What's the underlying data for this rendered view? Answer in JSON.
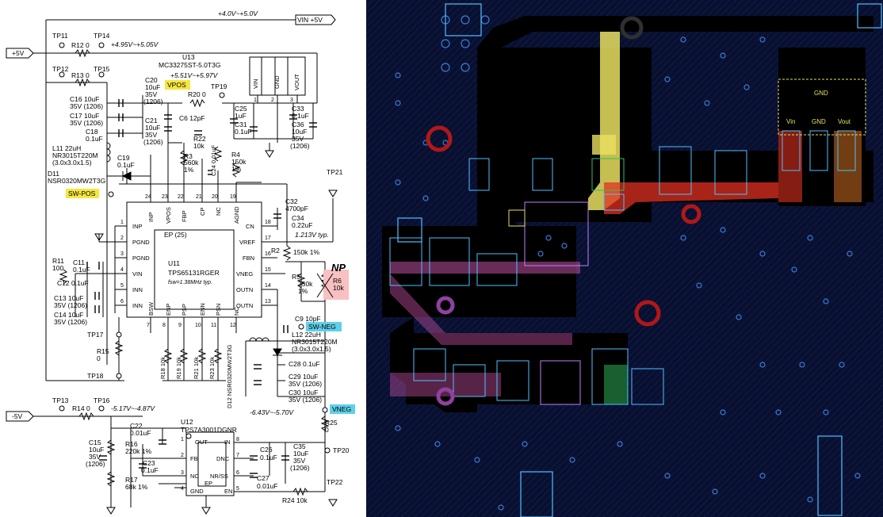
{
  "schematic": {
    "nets": {
      "vin_range": "+4.0V~+5.0V",
      "vin_label": "VIN +5V",
      "plus5": "+5V",
      "minus5": "-5V",
      "tp14_range": "+4.95V~+5.05V",
      "vpos_range": "+5.51V~+5.97V",
      "vneg_range": "-6.43V~-5.70V",
      "tp16_range": "-5.17V~-4.87V",
      "vref_note": "1.213V typ.",
      "np": "NP"
    },
    "tags": {
      "vpos": "VPOS",
      "sw_pos": "SW-POS",
      "sw_neg": "SW-NEG",
      "vneg": "VNEG"
    },
    "tps": [
      "TP11",
      "TP14",
      "TP12",
      "TP15",
      "TP19",
      "TP21",
      "TP17",
      "TP18",
      "TP13",
      "TP16",
      "TP20",
      "TP22"
    ],
    "u13": {
      "ref": "U13",
      "part": "MC33275ST-5.0T3G",
      "pins": [
        "VIN",
        "GND",
        "VOUT"
      ],
      "nums": [
        "1",
        "2",
        "3"
      ]
    },
    "u11": {
      "ref": "U11",
      "part": "TPS65131RGER",
      "freq": "fsw=1.38MHz typ.",
      "ep": "EP (25)",
      "top_pins": [
        "INP",
        "VPOS",
        "FBP",
        "CP",
        "NC",
        "AGND"
      ],
      "top_nums": [
        "24",
        "23",
        "22",
        "21",
        "20",
        "19"
      ],
      "left_pins": [
        "INP",
        "PGND",
        "PGND",
        "VIN",
        "INN",
        "INN"
      ],
      "left_nums": [
        "1",
        "2",
        "3",
        "4",
        "5",
        "6"
      ],
      "right_pins": [
        "CN",
        "VREF",
        "FBN",
        "VNEG",
        "OUTN",
        "OUTN"
      ],
      "right_nums": [
        "18",
        "17",
        "16",
        "15",
        "14",
        "13"
      ],
      "bottom_pins": [
        "BSW",
        "ENP",
        "PSP",
        "ENN",
        "PSN",
        "NC"
      ],
      "bottom_nums": [
        "7",
        "8",
        "9",
        "10",
        "11",
        "12"
      ]
    },
    "u12": {
      "ref": "U12",
      "part": "TPS7A3001DGNR",
      "pins_l": [
        "OUT",
        "FB",
        "NC",
        "GND"
      ],
      "pins_r": [
        "IN",
        "DNC",
        "NR/SS",
        "EN"
      ],
      "nums_l": [
        "1",
        "2",
        "3",
        "4"
      ],
      "nums_r": [
        "8",
        "7",
        "6",
        "5"
      ],
      "ep": "EP"
    },
    "components": [
      {
        "ref": "R12",
        "val": "0"
      },
      {
        "ref": "R13",
        "val": "0"
      },
      {
        "ref": "C16",
        "val": "10uF",
        "v2": "35V (1206)"
      },
      {
        "ref": "C17",
        "val": "10uF",
        "v2": "35V (1206)"
      },
      {
        "ref": "C18",
        "val": "0.1uF"
      },
      {
        "ref": "L11",
        "val": "22uH",
        "v2": "NR3015T220M",
        "v3": "(3.0x3.0x1.5)"
      },
      {
        "ref": "C19",
        "val": "0.1uF"
      },
      {
        "ref": "D11",
        "val": "NSR0320MW2T3G"
      },
      {
        "ref": "C20",
        "val": "10uF",
        "v2": "35V",
        "v3": "(1206)"
      },
      {
        "ref": "C21",
        "val": "10uF",
        "v2": "35V",
        "v3": "(1206)"
      },
      {
        "ref": "R20",
        "val": "0"
      },
      {
        "ref": "C6",
        "val": "12pF"
      },
      {
        "ref": "R22",
        "val": "10k"
      },
      {
        "ref": "R3",
        "val": "560k",
        "v2": "1%"
      },
      {
        "ref": "C24",
        "val": "0.01uF"
      },
      {
        "ref": "R4",
        "val": "150k",
        "v2": "1%"
      },
      {
        "ref": "C25",
        "val": "1uF"
      },
      {
        "ref": "C31",
        "val": "0.1uF"
      },
      {
        "ref": "C33",
        "val": "0.1uF"
      },
      {
        "ref": "C36",
        "val": "10uF",
        "v2": "35V",
        "v3": "(1206)"
      },
      {
        "ref": "C32",
        "val": "4700pF"
      },
      {
        "ref": "C34",
        "val": "0.22uF"
      },
      {
        "ref": "R2",
        "val": "150k 1%"
      },
      {
        "ref": "R5",
        "val": "750k",
        "v2": "1%"
      },
      {
        "ref": "R6",
        "val": "10k"
      },
      {
        "ref": "R11",
        "val": "100"
      },
      {
        "ref": "C11",
        "val": "0.1uF"
      },
      {
        "ref": "C12",
        "val": "0.1uF"
      },
      {
        "ref": "C13",
        "val": "10uF",
        "v2": "35V (1206)"
      },
      {
        "ref": "C14",
        "val": "10uF",
        "v2": "35V (1206)"
      },
      {
        "ref": "R15",
        "val": "0"
      },
      {
        "ref": "R18",
        "val": "10k"
      },
      {
        "ref": "R19",
        "val": "10k"
      },
      {
        "ref": "R21",
        "val": "10k"
      },
      {
        "ref": "R23",
        "val": "10k"
      },
      {
        "ref": "C9",
        "val": "10pF"
      },
      {
        "ref": "L12",
        "val": "22uH",
        "v2": "NR3015T220M",
        "v3": "(3.0x3.0x1.5)"
      },
      {
        "ref": "D12",
        "val": "NSR0320MW2T3G"
      },
      {
        "ref": "C28",
        "val": "0.1uF"
      },
      {
        "ref": "C29",
        "val": "10uF",
        "v2": "35V (1206)"
      },
      {
        "ref": "C30",
        "val": "10uF",
        "v2": "35V (1206)"
      },
      {
        "ref": "R25",
        "val": "0"
      },
      {
        "ref": "R14",
        "val": "0"
      },
      {
        "ref": "C22",
        "val": "0.01uF"
      },
      {
        "ref": "R16",
        "val": "220k 1%"
      },
      {
        "ref": "C15",
        "val": "10uF",
        "v2": "35V",
        "v3": "(1206)"
      },
      {
        "ref": "C23",
        "val": "0.1uF"
      },
      {
        "ref": "R17",
        "val": "68k 1%"
      },
      {
        "ref": "C26",
        "val": "0.1uF"
      },
      {
        "ref": "C27",
        "val": "0.01uF"
      },
      {
        "ref": "C35",
        "val": "10uF",
        "v2": "35V",
        "v3": "(1206)"
      },
      {
        "ref": "R24",
        "val": "10k"
      }
    ]
  },
  "pcb": {
    "ldo_pins": [
      "Vin",
      "GND",
      "Vout"
    ],
    "ldo_tab": "GND",
    "colors": {
      "bg": "#0a1030",
      "copper": "#000000",
      "grid": "#1f3a8c",
      "via": "#3a7dd8",
      "yellow": "#e8e060",
      "red": "#e03020",
      "pink": "#c050a0",
      "green": "#30c060"
    }
  }
}
